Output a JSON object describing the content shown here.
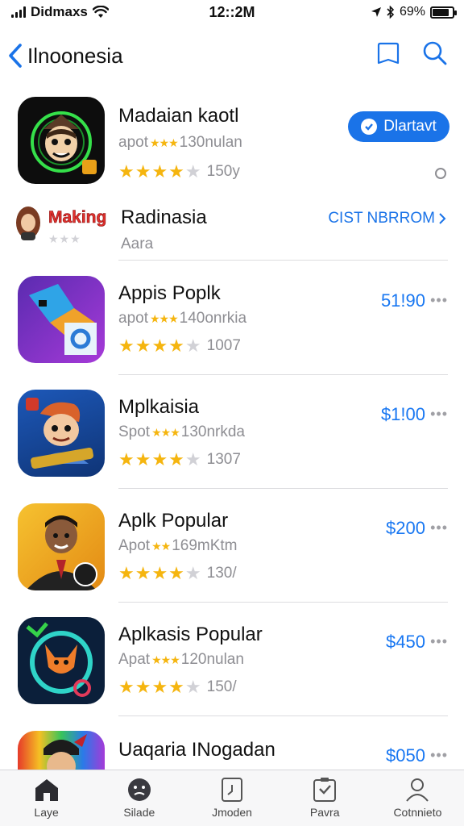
{
  "status_bar": {
    "carrier": "Didmaxs",
    "time": "12::2M",
    "battery": "69%"
  },
  "header": {
    "title": "Ilnoonesia"
  },
  "featured": {
    "name": "Madaian kaotl",
    "sub_prefix": "apot",
    "sub_suffix": "130nulan",
    "rating_count": "150y",
    "get_label": "Dlartavt"
  },
  "section": {
    "badge": "Making",
    "name": "Radinasia",
    "sub": "Aara",
    "link_label": "CIST NBRROM"
  },
  "apps": [
    {
      "name": "Appis Poplk",
      "sub_prefix": "apot",
      "sub_suffix": "140onrkia",
      "count": "1007",
      "price": "51!90"
    },
    {
      "name": "Mplkaisia",
      "sub_prefix": "Spot",
      "sub_suffix": "130nrkda",
      "count": "1307",
      "price": "$1!00"
    },
    {
      "name": "Aplk Popular",
      "sub_prefix": "Apot",
      "sub_suffix": "169mKtm",
      "count": "130/",
      "price": "$200"
    },
    {
      "name": "Aplkasis Popular",
      "sub_prefix": "Apat",
      "sub_suffix": "120nulan",
      "count": "150/",
      "price": "$450"
    },
    {
      "name": "Uaqaria INogadan",
      "price": "$050"
    }
  ],
  "tabs": [
    {
      "label": "Laye",
      "icon": "home-icon"
    },
    {
      "label": "Silade",
      "icon": "face-icon"
    },
    {
      "label": "Jmoden",
      "icon": "document-icon"
    },
    {
      "label": "Pavra",
      "icon": "check-doc-icon"
    },
    {
      "label": "Cotnnieto",
      "icon": "person-icon"
    }
  ],
  "colors": {
    "accent": "#1a73e8",
    "star": "#f5b50f",
    "badge_red": "#e0312d"
  }
}
